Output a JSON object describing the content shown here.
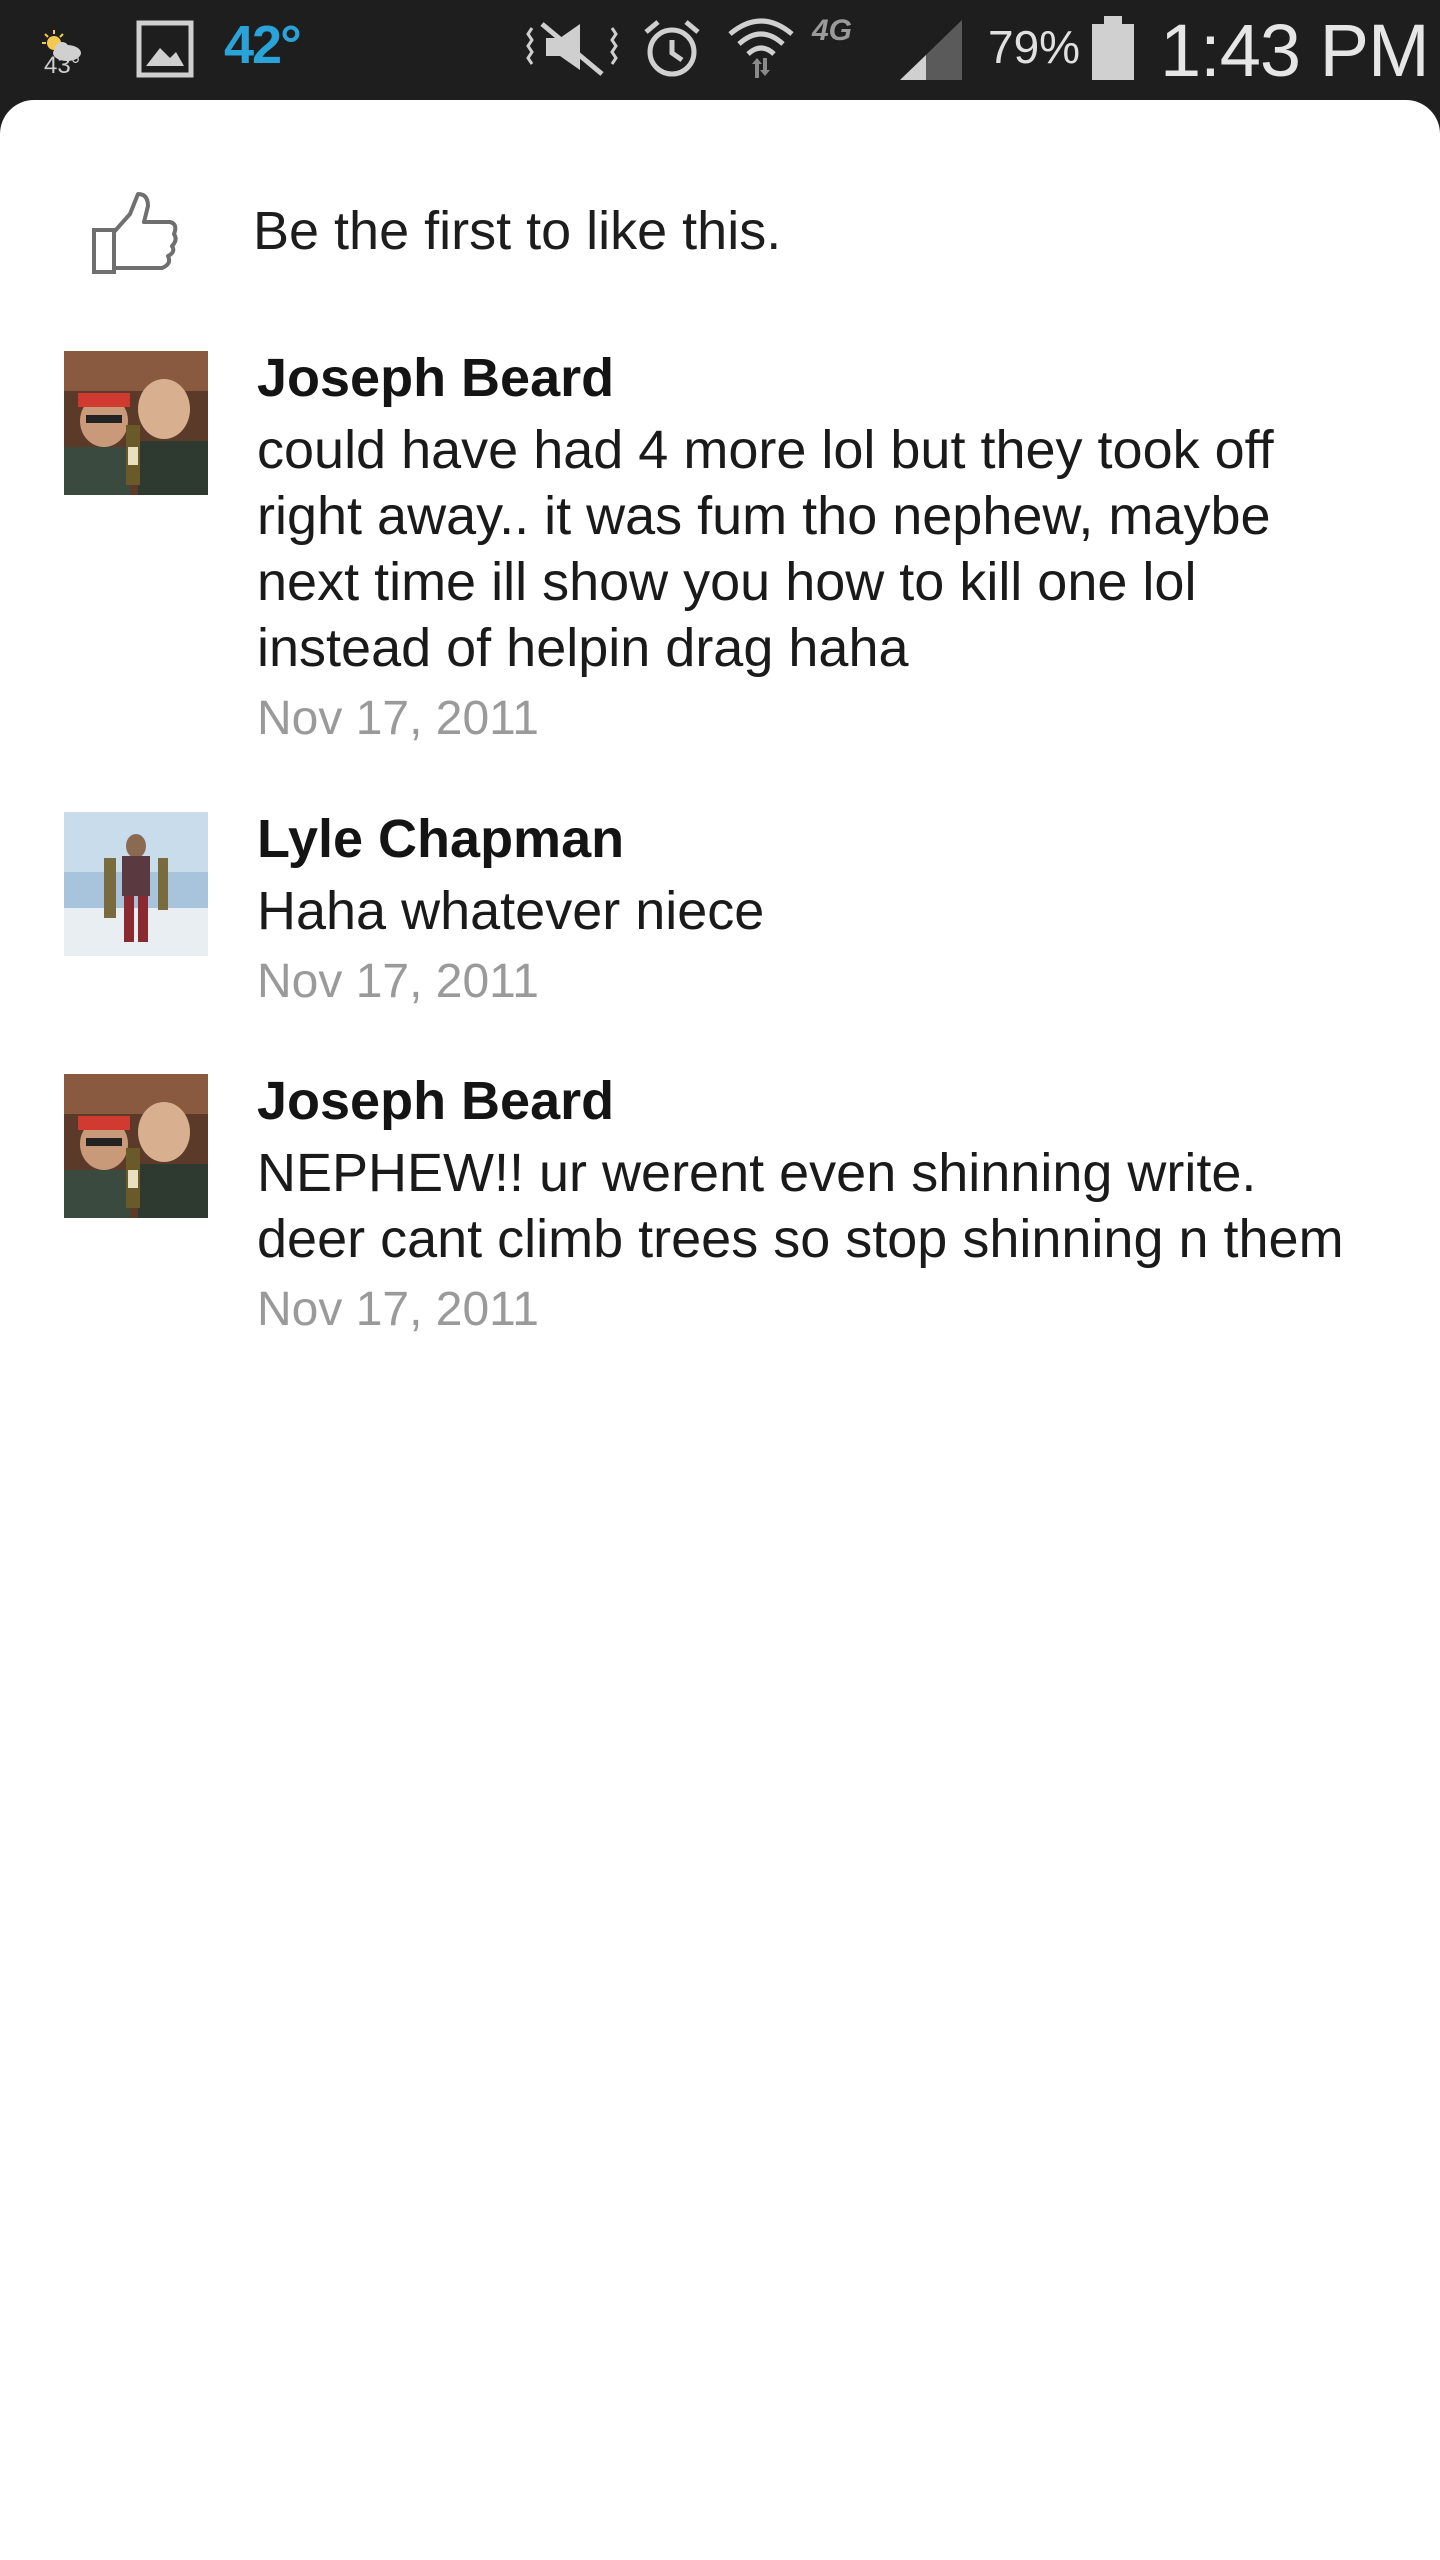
{
  "status_bar": {
    "weather_temp": "43°",
    "temperature": "42°",
    "network": "4G",
    "battery_percent": "79%",
    "time": "1:43 PM",
    "icons": [
      "weather-icon",
      "gallery-icon",
      "mute-vibrate-icon",
      "alarm-icon",
      "wifi-icon",
      "signal-icon",
      "battery-icon"
    ]
  },
  "likes": {
    "text": "Be the first to like this.",
    "icon": "thumbs-up-icon"
  },
  "comments": [
    {
      "author": "Joseph Beard",
      "text": "could have had 4 more lol but they took off right away.. it was fum tho nephew, maybe next time ill show you how to kill one lol instead of helpin drag haha",
      "date": "Nov 17, 2011"
    },
    {
      "author": "Lyle Chapman",
      "text": "Haha whatever niece",
      "date": "Nov 17, 2011"
    },
    {
      "author": "Joseph Beard",
      "text": "NEPHEW!! ur werent even shinning write. deer cant climb trees so stop shinning n them",
      "date": "Nov 17, 2011"
    }
  ],
  "colors": {
    "status_bar_bg": "#1e1e1e",
    "temperature_accent": "#2aa3d8",
    "date_gray": "#9a9a9a"
  }
}
